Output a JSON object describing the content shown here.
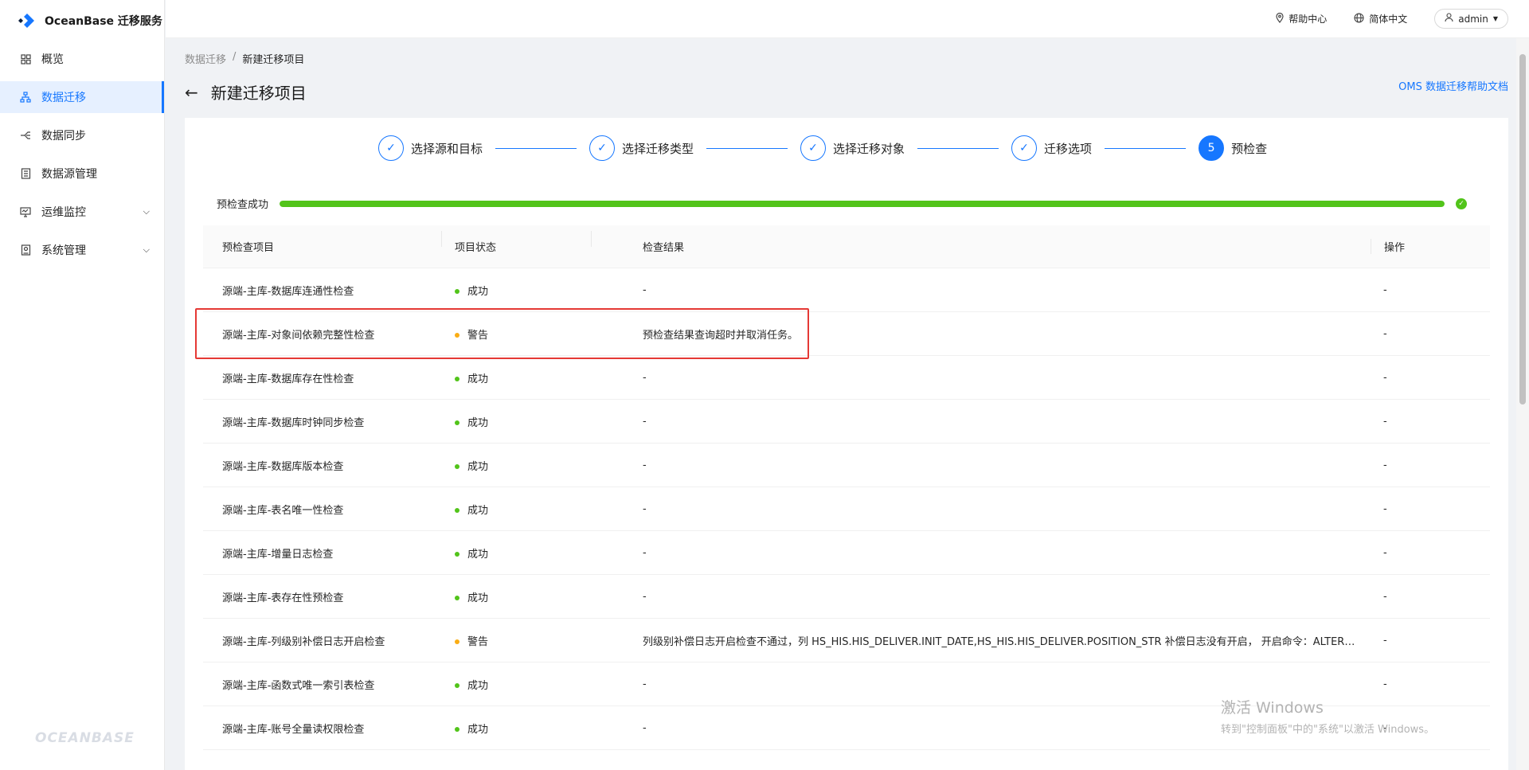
{
  "app": {
    "name": "OceanBase 迁移服务",
    "footer_brand": "OCEANBASE"
  },
  "sidebar": {
    "items": [
      {
        "label": "概览",
        "icon": "grid-icon"
      },
      {
        "label": "数据迁移",
        "icon": "sitemap-icon",
        "active": true
      },
      {
        "label": "数据同步",
        "icon": "sync-branch-icon"
      },
      {
        "label": "数据源管理",
        "icon": "database-doc-icon"
      },
      {
        "label": "运维监控",
        "icon": "monitor-icon",
        "expandable": true
      },
      {
        "label": "系统管理",
        "icon": "settings-panel-icon",
        "expandable": true
      }
    ]
  },
  "topbar": {
    "help": "帮助中心",
    "language": "简体中文",
    "user": "admin"
  },
  "breadcrumb": {
    "parent": "数据迁移",
    "separator": "/",
    "current": "新建迁移项目"
  },
  "page": {
    "title": "新建迁移项目",
    "help_doc": "OMS 数据迁移帮助文档"
  },
  "steps": [
    {
      "label": "选择源和目标",
      "state": "done"
    },
    {
      "label": "选择迁移类型",
      "state": "done"
    },
    {
      "label": "选择迁移对象",
      "state": "done"
    },
    {
      "label": "迁移选项",
      "state": "done"
    },
    {
      "label": "预检查",
      "state": "current",
      "number": "5"
    }
  ],
  "progress": {
    "label": "预检查成功",
    "percent": 100,
    "color": "#52c41a"
  },
  "table": {
    "headers": {
      "item": "预检查项目",
      "status": "项目状态",
      "result": "检查结果",
      "action": "操作"
    },
    "rows": [
      {
        "item": "源端-主库-数据库连通性检查",
        "status": "成功",
        "level": "success",
        "result": "-",
        "action": "-"
      },
      {
        "item": "源端-主库-对象间依赖完整性检查",
        "status": "警告",
        "level": "warning",
        "result": "预检查结果查询超时并取消任务。",
        "action": "-"
      },
      {
        "item": "源端-主库-数据库存在性检查",
        "status": "成功",
        "level": "success",
        "result": "-",
        "action": "-"
      },
      {
        "item": "源端-主库-数据库时钟同步检查",
        "status": "成功",
        "level": "success",
        "result": "-",
        "action": "-"
      },
      {
        "item": "源端-主库-数据库版本检查",
        "status": "成功",
        "level": "success",
        "result": "-",
        "action": "-"
      },
      {
        "item": "源端-主库-表名唯一性检查",
        "status": "成功",
        "level": "success",
        "result": "-",
        "action": "-"
      },
      {
        "item": "源端-主库-增量日志检查",
        "status": "成功",
        "level": "success",
        "result": "-",
        "action": "-"
      },
      {
        "item": "源端-主库-表存在性预检查",
        "status": "成功",
        "level": "success",
        "result": "-",
        "action": "-"
      },
      {
        "item": "源端-主库-列级别补偿日志开启检查",
        "status": "警告",
        "level": "warning",
        "result": "列级别补偿日志开启检查不通过，列 HS_HIS.HIS_DELIVER.INIT_DATE,HS_HIS.HIS_DELIVER.POSITION_STR 补偿日志没有开启， 开启命令：ALTER TAB...",
        "action": "-"
      },
      {
        "item": "源端-主库-函数式唯一索引表检查",
        "status": "成功",
        "level": "success",
        "result": "-",
        "action": "-"
      },
      {
        "item": "源端-主库-账号全量读权限检查",
        "status": "成功",
        "level": "success",
        "result": "-",
        "action": "-"
      }
    ]
  },
  "colors": {
    "success": "#52c41a",
    "warning": "#faad14",
    "primary": "#1677ff",
    "highlight": "#e53935"
  },
  "watermark": {
    "line1": "激活 Windows",
    "line2": "转到\"控制面板\"中的\"系统\"以激活 Windows。"
  }
}
